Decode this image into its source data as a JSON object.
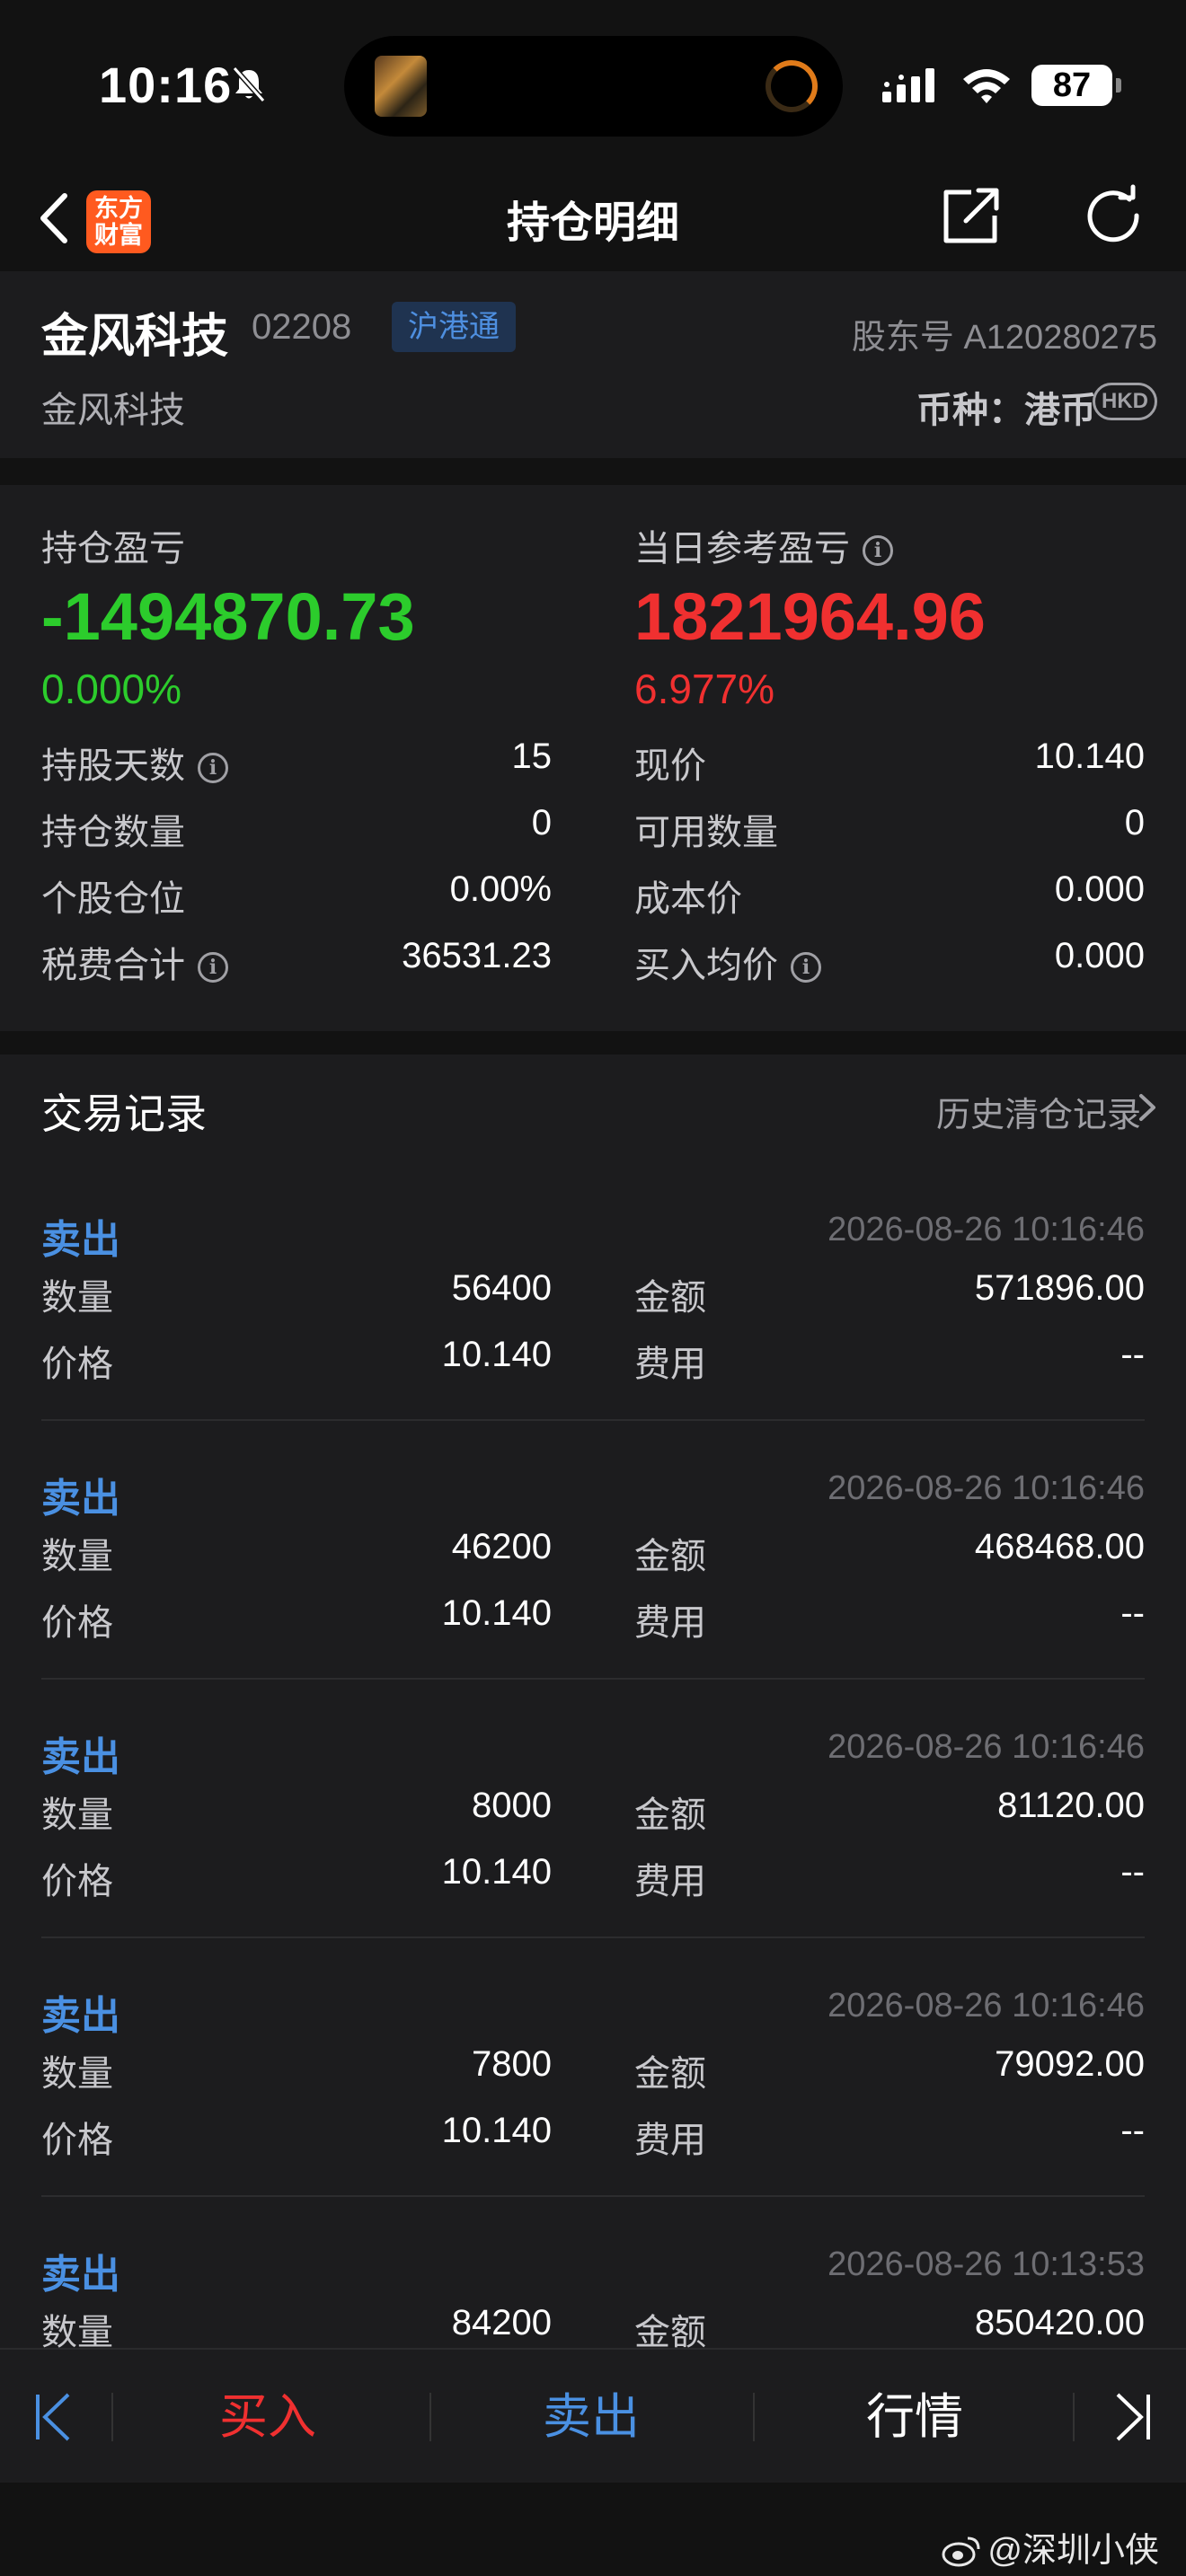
{
  "status_bar": {
    "time": "10:16",
    "battery": "87"
  },
  "nav": {
    "title": "持仓明细",
    "logo_line1": "东方",
    "logo_line2": "财富"
  },
  "stock": {
    "name": "金风科技",
    "code": "02208",
    "tag": "沪港通",
    "holder_id": "股东号 A120280275",
    "sub_name": "金风科技",
    "currency": "币种：港币",
    "currency_badge": "HKD"
  },
  "pnl": {
    "position_label": "持仓盈亏",
    "position_value": "-1494870.73",
    "position_pct": "0.000%",
    "daily_label": "当日参考盈亏",
    "daily_value": "1821964.96",
    "daily_pct": "6.977%",
    "rows": [
      {
        "l_label": "持股天数",
        "l_info": true,
        "l_value": "15",
        "r_label": "现价",
        "r_info": false,
        "r_value": "10.140"
      },
      {
        "l_label": "持仓数量",
        "l_info": false,
        "l_value": "0",
        "r_label": "可用数量",
        "r_info": false,
        "r_value": "0"
      },
      {
        "l_label": "个股仓位",
        "l_info": false,
        "l_value": "0.00%",
        "r_label": "成本价",
        "r_info": false,
        "r_value": "0.000"
      },
      {
        "l_label": "税费合计",
        "l_info": true,
        "l_value": "36531.23",
        "r_label": "买入均价",
        "r_info": true,
        "r_value": "0.000"
      }
    ]
  },
  "trades": {
    "title": "交易记录",
    "history_link": "历史清仓记录",
    "qty_label": "数量",
    "price_label": "价格",
    "amount_label": "金额",
    "fee_label": "费用",
    "items": [
      {
        "side": "卖出",
        "time": "2026-08-26 10:16:46",
        "qty": "56400",
        "price": "10.140",
        "amount": "571896.00",
        "fee": "--"
      },
      {
        "side": "卖出",
        "time": "2026-08-26 10:16:46",
        "qty": "46200",
        "price": "10.140",
        "amount": "468468.00",
        "fee": "--"
      },
      {
        "side": "卖出",
        "time": "2026-08-26 10:16:46",
        "qty": "8000",
        "price": "10.140",
        "amount": "81120.00",
        "fee": "--"
      },
      {
        "side": "卖出",
        "time": "2026-08-26 10:16:46",
        "qty": "7800",
        "price": "10.140",
        "amount": "79092.00",
        "fee": "--"
      },
      {
        "side": "卖出",
        "time": "2026-08-26 10:13:53",
        "qty": "84200",
        "price": "",
        "amount": "850420.00",
        "fee": ""
      }
    ]
  },
  "bottom_bar": {
    "buy": "买入",
    "sell": "卖出",
    "market": "行情"
  },
  "watermark": "@深圳小侠",
  "colors": {
    "accent_blue": "#4a90e2",
    "gain_red": "#f03030",
    "loss_green": "#2ccc2c",
    "brand_orange": "#ff5a1f"
  }
}
